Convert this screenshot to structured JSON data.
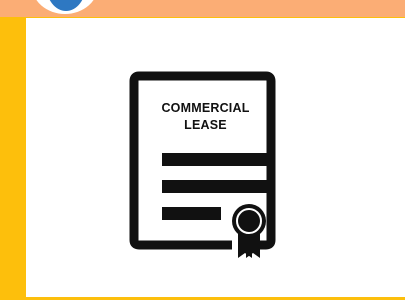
{
  "document_icon": {
    "title_line_1": "COMMERCIAL",
    "title_line_2": "LEASE",
    "icon_name": "commercial-lease-document-icon",
    "seal_icon_name": "ribbon-seal-icon"
  },
  "colors": {
    "background": "#fdbf0c",
    "top_band": "#fbad75",
    "badge_accent": "#2e78c2",
    "card": "#ffffff",
    "ink": "#111111"
  }
}
